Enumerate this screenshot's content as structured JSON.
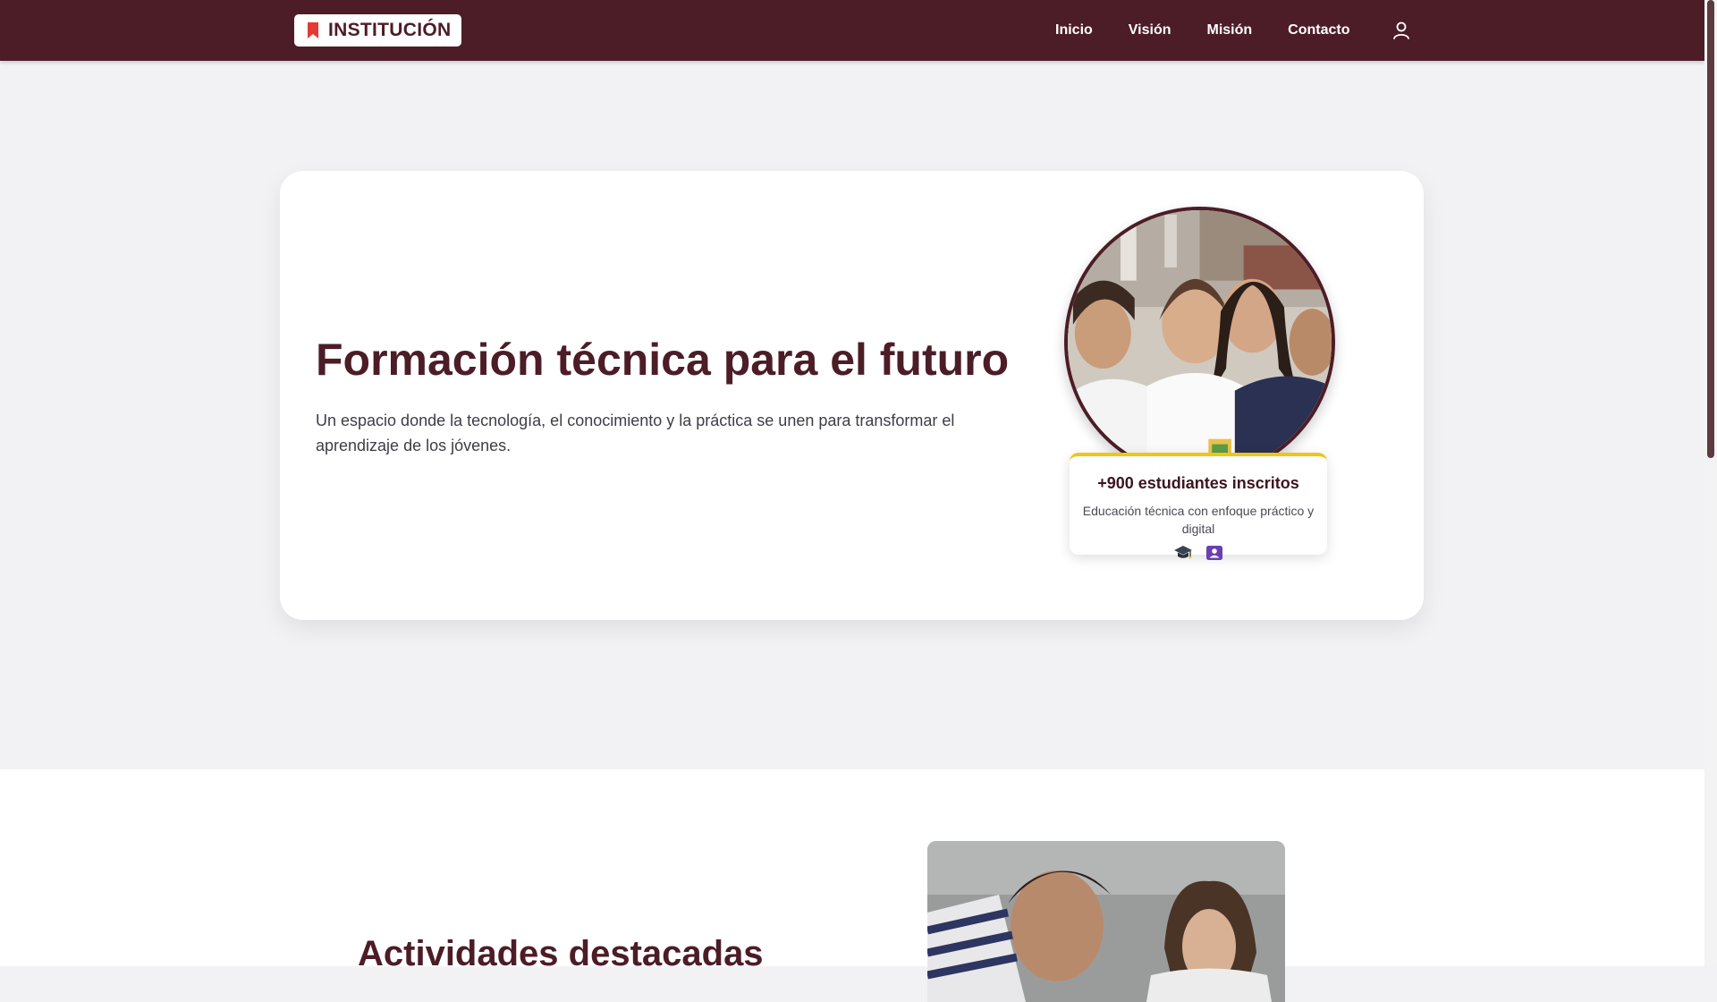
{
  "brand": {
    "name": "INSTITUCIÓN",
    "icon": "bookmark-icon",
    "icon_color": "#e53935"
  },
  "nav": {
    "links": [
      "Inicio",
      "Visión",
      "Misión",
      "Contacto"
    ],
    "user_icon": "user-icon",
    "background": "#4c1d27"
  },
  "hero": {
    "title": "Formación técnica para el futuro",
    "subtitle": "Un espacio donde la tecnología, el conocimiento y la práctica se unen para transformar el aprendizaje de los jóvenes.",
    "photo": "students-photo",
    "stat": {
      "title": "+900 estudiantes inscritos",
      "description": "Educación técnica con enfoque práctico y digital",
      "icons": [
        "graduation-cap-icon",
        "student-badge-icon"
      ],
      "accent": "#f0c419"
    }
  },
  "activities": {
    "title": "Actividades destacadas",
    "photo": "activity-photo"
  },
  "colors": {
    "primary": "#4c1d27",
    "accent": "#f0c419",
    "badge": "#6a3fb0",
    "page_bg": "#f2f2f4"
  }
}
